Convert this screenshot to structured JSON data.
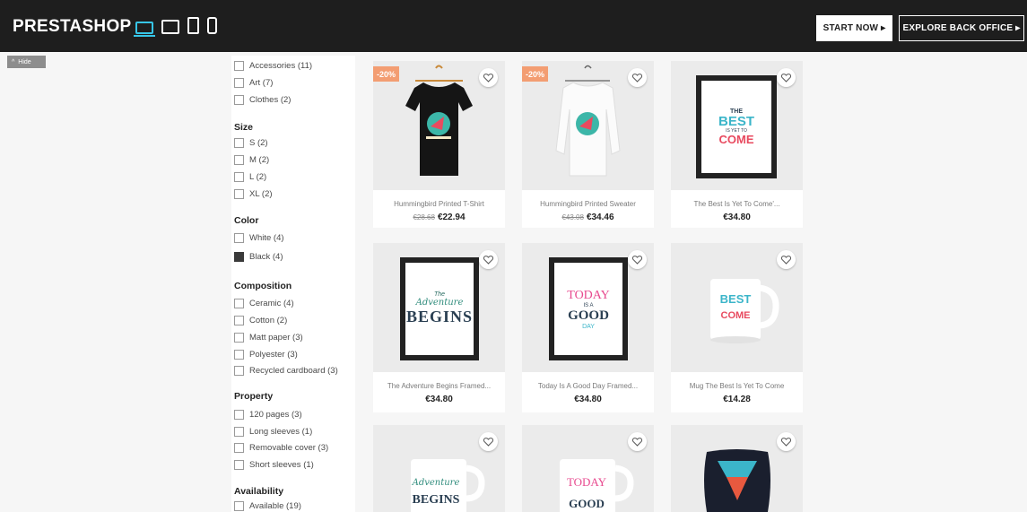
{
  "topbar": {
    "logo": "PRESTASHOP",
    "devices": [
      {
        "icon": "desktop-icon",
        "active": true
      },
      {
        "icon": "tablet-landscape-icon",
        "active": false
      },
      {
        "icon": "tablet-portrait-icon",
        "active": false
      },
      {
        "icon": "mobile-icon",
        "active": false
      }
    ],
    "start_now": "START NOW ▸",
    "explore": "EXPLORE BACK OFFICE ▸"
  },
  "hide_label": "Hide",
  "facets": {
    "categories": [
      "Accessories (11)",
      "Art (7)",
      "Clothes (2)"
    ],
    "size": {
      "title": "Size",
      "items": [
        "S (2)",
        "M (2)",
        "L (2)",
        "XL (2)"
      ]
    },
    "color": {
      "title": "Color",
      "items": [
        {
          "label": "White (4)",
          "checked": false
        },
        {
          "label": "Black (4)",
          "checked": true
        }
      ]
    },
    "composition": {
      "title": "Composition",
      "items": [
        "Ceramic (4)",
        "Cotton (2)",
        "Matt paper (3)",
        "Polyester (3)",
        "Recycled cardboard (3)"
      ]
    },
    "property": {
      "title": "Property",
      "items": [
        "120 pages (3)",
        "Long sleeves (1)",
        "Removable cover (3)",
        "Short sleeves (1)"
      ]
    },
    "availability": {
      "title": "Availability",
      "items": [
        "Available (19)"
      ]
    }
  },
  "products": [
    {
      "name": "Hummingbird Printed T-Shirt",
      "old_price": "€28.68",
      "price": "€22.94",
      "badge": "-20%"
    },
    {
      "name": "Hummingbird Printed Sweater",
      "old_price": "€43.08",
      "price": "€34.46",
      "badge": "-20%"
    },
    {
      "name": "The Best Is Yet To Come'...",
      "old_price": "",
      "price": "€34.80",
      "badge": ""
    },
    {
      "name": "The Adventure Begins Framed...",
      "old_price": "",
      "price": "€34.80",
      "badge": ""
    },
    {
      "name": "Today Is A Good Day Framed...",
      "old_price": "",
      "price": "€34.80",
      "badge": ""
    },
    {
      "name": "Mug The Best Is Yet To Come",
      "old_price": "",
      "price": "€14.28",
      "badge": ""
    }
  ],
  "artwork": {
    "best": [
      "THE",
      "BEST",
      "IS YET TO",
      "COME"
    ],
    "adventure": [
      "The",
      "Adventure",
      "BEGINS"
    ],
    "today": [
      "TODAY",
      "IS A",
      "GOOD",
      "DAY"
    ]
  },
  "colors": {
    "accent": "#37c6e8",
    "badge": "#f39d72",
    "topbar": "#1e1e1e"
  }
}
